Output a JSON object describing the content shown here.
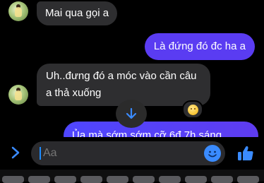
{
  "colors": {
    "background": "#000000",
    "incoming_bubble": "#2e2e30",
    "outgoing_bubble": "#5a3cf2",
    "accent": "#3a8bff"
  },
  "messages": [
    {
      "direction": "incoming",
      "text": "Mai qua gọi a"
    },
    {
      "direction": "outgoing",
      "text": "Là đứng đó đc ha a"
    },
    {
      "direction": "incoming",
      "text": "Uh..đưng đó a móc vào cần câu a thả xuống",
      "reaction": "grinning-face"
    },
    {
      "direction": "outgoing",
      "text": "Ủa mà sớm sớm cỡ 6đ 7h sáng"
    }
  ],
  "composer": {
    "placeholder": "Aa"
  },
  "icons": {
    "expand": "chevron-right-icon",
    "scroll": "arrow-down-icon",
    "emoji": "emoji-icon",
    "like": "thumbs-up-icon"
  }
}
